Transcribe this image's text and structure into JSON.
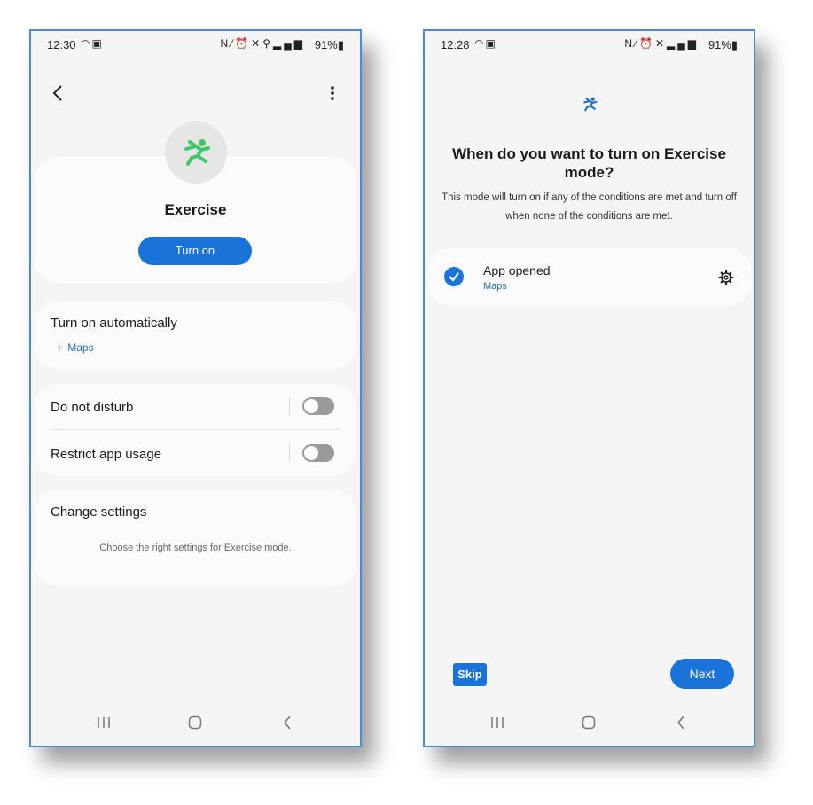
{
  "left_phone": {
    "status": {
      "time": "12:30",
      "battery": "91%"
    },
    "header": {
      "back_icon": "back-arrow-icon",
      "more_icon": "more-vert-icon"
    },
    "mode": {
      "icon": "running-person-icon",
      "icon_color": "#3ec86a",
      "title": "Exercise",
      "turn_on_label": "Turn on"
    },
    "auto": {
      "title": "Turn on automatically",
      "app_icon": "apps-icon",
      "app_label": "Maps"
    },
    "toggles": [
      {
        "label": "Do not disturb",
        "state": "off"
      },
      {
        "label": "Restrict app usage",
        "state": "off"
      }
    ],
    "settings": {
      "title": "Change settings",
      "hint": "Choose the right settings for Exercise mode."
    }
  },
  "right_phone": {
    "status": {
      "time": "12:28",
      "battery": "91%"
    },
    "mode": {
      "icon": "running-person-icon",
      "icon_color": "#1e6fc4"
    },
    "question": "When do you want to turn on Exercise mode?",
    "description": "This mode will turn on if any of the conditions are met and turn off when none of the conditions are met.",
    "condition": {
      "title": "App opened",
      "subtitle": "Maps",
      "checked": true,
      "settings_icon": "gear-icon"
    },
    "skip_label": "Skip",
    "next_label": "Next"
  },
  "colors": {
    "accent": "#1a73d9",
    "frame_border": "#4a8ad4",
    "background": "#f5f5f5"
  }
}
